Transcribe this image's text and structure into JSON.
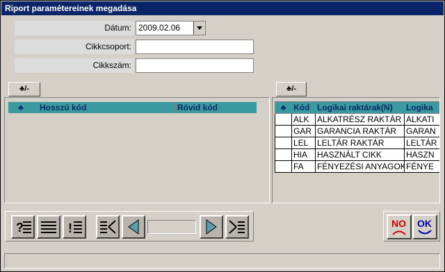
{
  "window": {
    "title": "Riport paramétereinek megadása"
  },
  "form": {
    "date_label": "Dátum:",
    "date_value": "2009.02.06",
    "group_label": "Cikkcsoport:",
    "group_value": "",
    "item_label": "Cikkszám:",
    "item_value": ""
  },
  "left_grid": {
    "toggle_label": "♣/-",
    "headers": [
      "♣",
      "Hosszú kód",
      "Rövid kód"
    ]
  },
  "right_grid": {
    "toggle_label": "♣/-",
    "headers": [
      "♣",
      "Kód",
      "Logikai raktárak(N)",
      "Logika"
    ],
    "rows": [
      [
        "",
        "ALK",
        "ALKATRÉSZ RAKTÁR",
        "ALKATI"
      ],
      [
        "",
        "GAR",
        "GARANCIA RAKTÁR",
        "GARAN"
      ],
      [
        "",
        "LEL",
        "LELTÁR RAKTÁR",
        "LELTÁR"
      ],
      [
        "",
        "HIA",
        "HASZNÁLT CIKK",
        "HASZN"
      ],
      [
        "",
        "FA",
        "FÉNYEZÉSI ANYAGOK",
        "FÉNYE"
      ]
    ]
  },
  "buttons": {
    "no_label": "NO",
    "ok_label": "OK"
  },
  "colors": {
    "titlebar": "#0a246a",
    "grid_header": "#3a9aa0",
    "no_text": "#cc0000",
    "ok_text": "#0000aa"
  }
}
